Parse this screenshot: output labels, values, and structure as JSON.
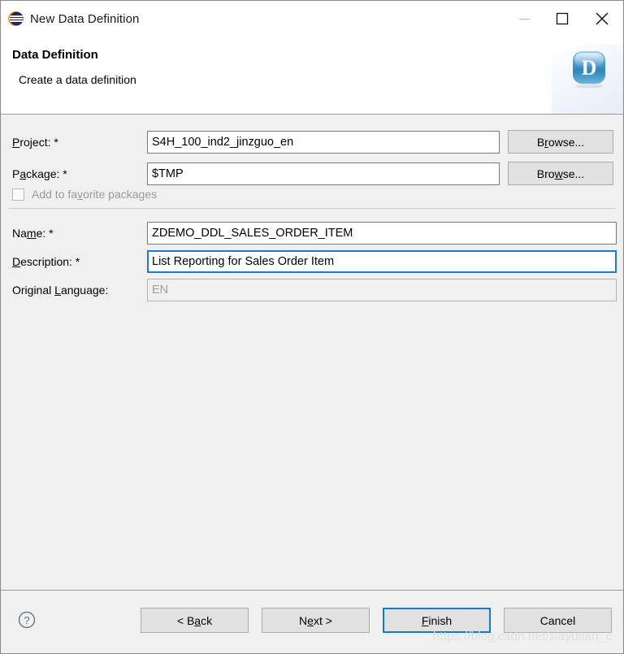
{
  "window": {
    "title": "New Data Definition",
    "icon": "eclipse-icon",
    "controls": {
      "minimize": "minimize-icon",
      "maximize": "maximize-icon",
      "close": "close-icon"
    }
  },
  "header": {
    "title": "Data Definition",
    "subtitle": "Create a data definition",
    "logo_letter": "D"
  },
  "form": {
    "project": {
      "label_pre": "",
      "label_mnemonic": "P",
      "label_post": "roject: *",
      "value": "S4H_100_ind2_jinzguo_en",
      "browse_pre": "B",
      "browse_mnemonic": "r",
      "browse_post": "owse..."
    },
    "package": {
      "label_pre": "P",
      "label_mnemonic": "a",
      "label_post": "ckage: *",
      "value": "$TMP",
      "browse_pre": "Bro",
      "browse_mnemonic": "w",
      "browse_post": "se..."
    },
    "favorite": {
      "label_pre": "Add to fa",
      "label_mnemonic": "v",
      "label_post": "orite packages",
      "checked": false,
      "enabled": false
    },
    "name": {
      "label_pre": "Na",
      "label_mnemonic": "m",
      "label_post": "e: *",
      "value": "ZDEMO_DDL_SALES_ORDER_ITEM"
    },
    "description": {
      "label_pre": "",
      "label_mnemonic": "D",
      "label_post": "escription: *",
      "value": "List Reporting for Sales Order Item",
      "focused": true
    },
    "original_language": {
      "label_pre": "Original ",
      "label_mnemonic": "L",
      "label_post": "anguage:",
      "value": "EN",
      "enabled": false
    }
  },
  "footer": {
    "help_icon": "help-icon",
    "back": {
      "pre": "< B",
      "mnemonic": "a",
      "post": "ck"
    },
    "next": {
      "pre": "N",
      "mnemonic": "e",
      "post": "xt >"
    },
    "finish": {
      "pre": "",
      "mnemonic": "F",
      "post": "inish",
      "is_default": true
    },
    "cancel": {
      "pre": "Cancel",
      "mnemonic": "",
      "post": ""
    }
  },
  "watermark": "https://blog.csdn.net/xiayutian_c",
  "colors": {
    "accent": "#0f7bd4",
    "focus_border": "#1a7ad4",
    "body_bg": "#f0f0f0",
    "button_bg": "#e1e1e1",
    "disabled_text": "#9a9a9a"
  }
}
